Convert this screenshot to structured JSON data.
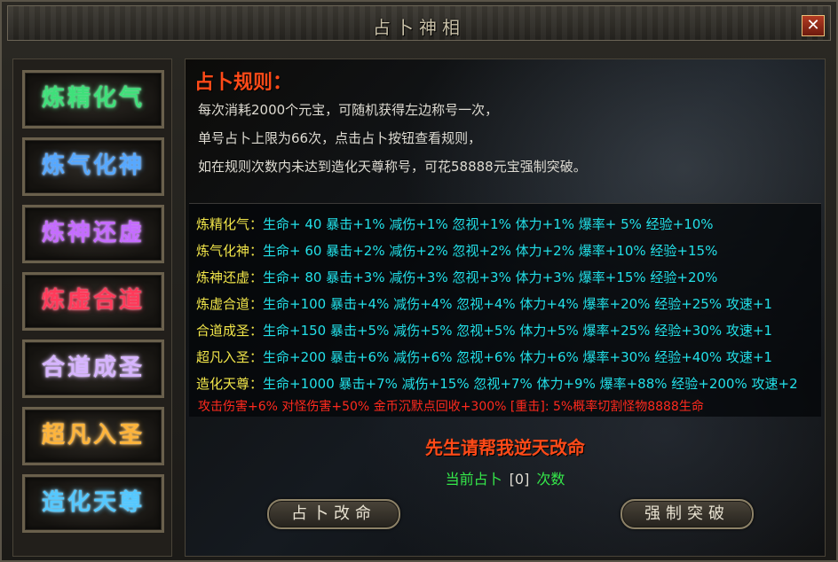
{
  "window": {
    "title": "占卜神相",
    "close_label": "✕"
  },
  "sidebar": {
    "titles": [
      {
        "label": "炼精化气",
        "color": "#3fe07a"
      },
      {
        "label": "炼气化神",
        "color": "#57a8ff"
      },
      {
        "label": "炼神还虚",
        "color": "#c56cff"
      },
      {
        "label": "炼虚合道",
        "color": "#ff3a5a"
      },
      {
        "label": "合道成圣",
        "color": "#d6b4ff"
      },
      {
        "label": "超凡入圣",
        "color": "#ffb43a"
      },
      {
        "label": "造化天尊",
        "color": "#55c8ff"
      }
    ]
  },
  "rules": {
    "title": "占卜规则：",
    "lines": [
      "每次消耗2000个元宝，可随机获得左边称号一次，",
      "单号占卜上限为66次，点击占卜按钮查看规则，",
      "如在规则次数内未达到造化天尊称号，可花58888元宝强制突破。"
    ]
  },
  "stats": [
    {
      "name": "炼精化气：",
      "values": "生命+ 40  暴击+1%  减伤+1%  忽视+1%  体力+1%  爆率+ 5%  经验+10%"
    },
    {
      "name": "炼气化神：",
      "values": "生命+ 60  暴击+2%  减伤+2%  忽视+2%  体力+2%  爆率+10%  经验+15%"
    },
    {
      "name": "炼神还虚：",
      "values": "生命+ 80  暴击+3%  减伤+3%  忽视+3%  体力+3%  爆率+15%  经验+20%"
    },
    {
      "name": "炼虚合道：",
      "values": "生命+100  暴击+4%  减伤+4%  忽视+4%  体力+4%  爆率+20%  经验+25%  攻速+1"
    },
    {
      "name": "合道成圣：",
      "values": "生命+150  暴击+5%  减伤+5%  忽视+5%  体力+5%  爆率+25%  经验+30%  攻速+1"
    },
    {
      "name": "超凡入圣：",
      "values": "生命+200  暴击+6%  减伤+6%  忽视+6%  体力+6%  爆率+30%  经验+40%  攻速+1"
    },
    {
      "name": "造化天尊：",
      "values": "生命+1000  暴击+7%  减伤+15%  忽视+7%  体力+9%  爆率+88%  经验+200%  攻速+2"
    }
  ],
  "extra_bonus": "攻击伤害+6% 对怪伤害+50% 金币沉默点回收+300% [重击]: 5%概率切割怪物8888生命",
  "bottom": {
    "prompt": "先生请帮我逆天改命",
    "count_prefix": "当前占卜",
    "count_value": "[0]",
    "count_suffix": "次数",
    "divine_button": "占卜改命",
    "force_button": "强制突破"
  }
}
